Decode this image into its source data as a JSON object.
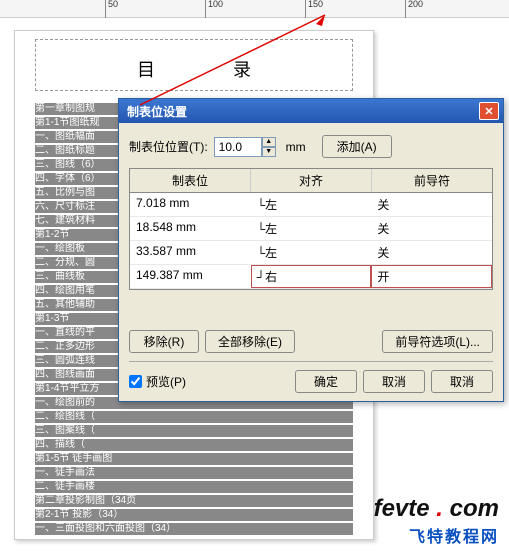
{
  "ruler": {
    "marks": [
      "50",
      "100",
      "150",
      "200"
    ]
  },
  "doc": {
    "title": "目　录",
    "toc": [
      "第一章制图规",
      "第1-1节图纸规",
      "一、图纸幅面",
      "二、图纸标题",
      "三、图线（6）",
      "四、字体（6）",
      "五、比例与图",
      "六、尺寸标注",
      "七、建筑材料",
      "第1-2节",
      "一、绘图板",
      "二、分规、圆",
      "三、曲线板",
      "四、绘图用笔",
      "五、其他辅助",
      "第1-3节",
      "一、直线的平",
      "二、正多边形",
      "三、圆弧连线",
      "四、图线画面",
      "第1-4节平立方",
      "一、绘图前的",
      "二、绘图线（",
      "三、图案线（",
      "四、描线（",
      "第1-5节 徒手画图",
      "一、徒手画法",
      "二、徒手画楼",
      "第二章投影制图（34页",
      "第2-1节    投影（34）",
      "一、三面投图和六面投图（34）"
    ]
  },
  "dialog": {
    "title": "制表位设置",
    "pos_label": "制表位位置(T):",
    "pos_value": "10.0",
    "unit": "mm",
    "add_btn": "添加(A)",
    "headers": {
      "tab": "制表位",
      "align": "对齐",
      "leader": "前导符"
    },
    "rows": [
      {
        "tab": "7.018 mm",
        "align": "└左",
        "leader": "关"
      },
      {
        "tab": "18.548 mm",
        "align": "└左",
        "leader": "关"
      },
      {
        "tab": "33.587 mm",
        "align": "└左",
        "leader": "关"
      },
      {
        "tab": "149.387 mm",
        "align": "┘右",
        "leader": "开",
        "hl": true
      }
    ],
    "remove_btn": "移除(R)",
    "remove_all_btn": "全部移除(E)",
    "leader_opts_btn": "前导符选项(L)...",
    "preview_label": "预览(P)",
    "preview_checked": true,
    "ok_btn": "确定",
    "cancel_btn": "取消",
    "cancel2_btn": "取消"
  },
  "watermark": {
    "logo_a": "fevte",
    "logo_b": "com",
    "sub": "飞特教程网"
  }
}
